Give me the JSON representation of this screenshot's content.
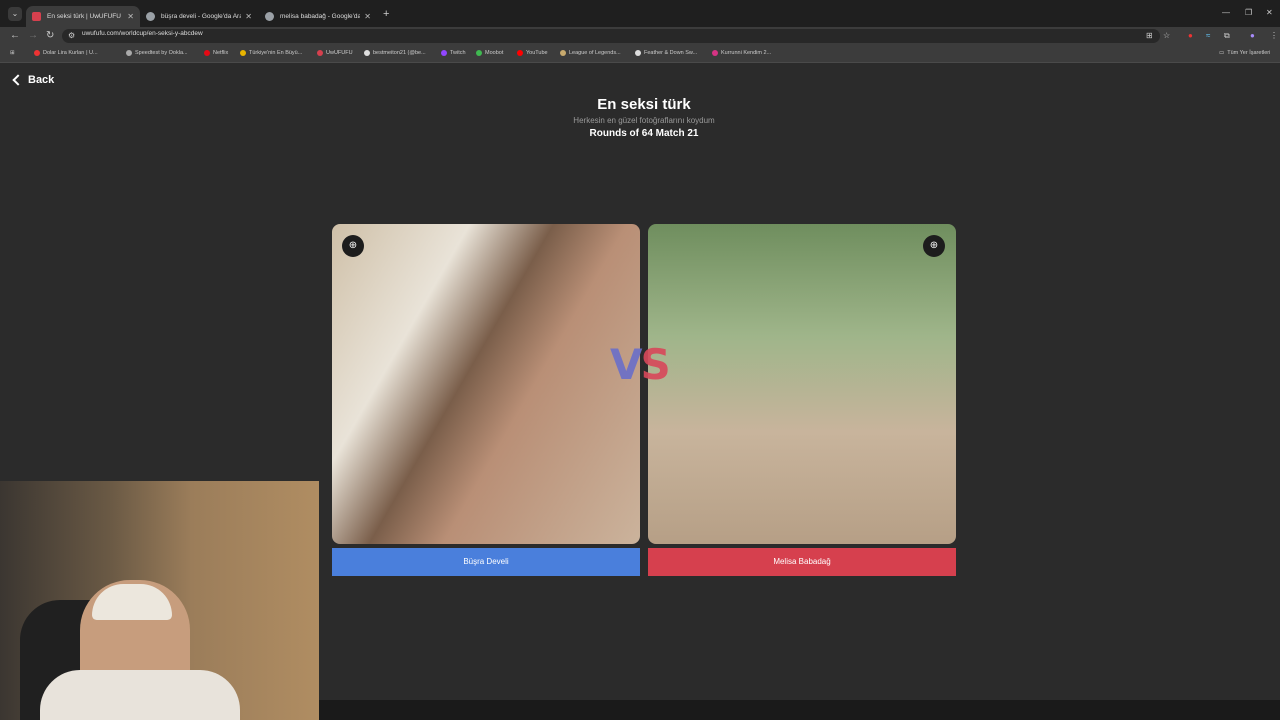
{
  "browser": {
    "tabs": [
      {
        "title": "En seksi türk | UwUFUFU",
        "active": true,
        "favicon_color": "#d6404e"
      },
      {
        "title": "büşra develi - Google'da Ara",
        "active": false,
        "favicon_color": "#9aa0a6"
      },
      {
        "title": "melisa babadağ - Google'da A",
        "active": false,
        "favicon_color": "#9aa0a6"
      }
    ],
    "url": "uwufufu.com/worldcup/en-seksi-y-abcdew",
    "bookmarks": [
      {
        "label": "Dolar Lira Kurları | U...",
        "color": "#e33"
      },
      {
        "label": "Speedtest by Ookla...",
        "color": "#aaa"
      },
      {
        "label": "Netflix",
        "color": "#e50914"
      },
      {
        "label": "Türkiye'nin En Büyü...",
        "color": "#e8b400"
      },
      {
        "label": "UwUFUFU",
        "color": "#d6404e"
      },
      {
        "label": "bestmeiton21 (@be...",
        "color": "#ddd"
      },
      {
        "label": "Twitch",
        "color": "#9146ff"
      },
      {
        "label": "Moobot",
        "color": "#3fb950"
      },
      {
        "label": "YouTube",
        "color": "#ff0000"
      },
      {
        "label": "League of Legends...",
        "color": "#c8aa6e"
      },
      {
        "label": "Feather & Down Sw...",
        "color": "#ddd"
      },
      {
        "label": "Kurrunni Kendim 2...",
        "color": "#d63384"
      }
    ],
    "other_bookmarks": "Tüm Yer İşaretleri"
  },
  "page": {
    "back_label": "Back",
    "title": "En seksi türk",
    "subtitle": "Herkesin en güzel fotoğraflarını koydum",
    "round_info": "Rounds of 64 Match 21",
    "vs": "VS",
    "left": {
      "name": "Büşra Develi",
      "color": "#4a7fdc"
    },
    "right": {
      "name": "Melisa Babadağ",
      "color": "#d6404e"
    }
  }
}
